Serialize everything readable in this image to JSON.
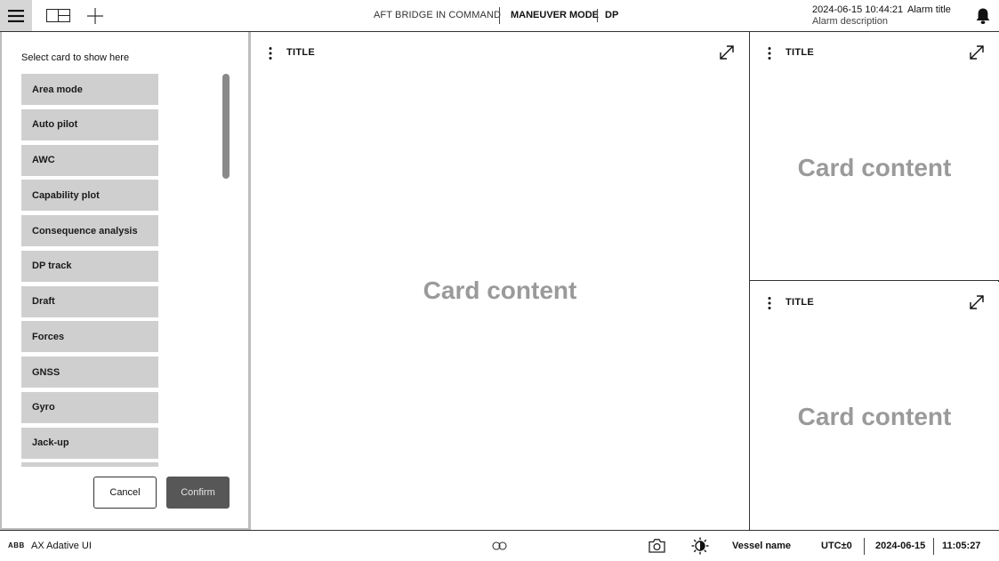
{
  "topbar": {
    "command_status": "AFT BRIDGE IN COMMAND",
    "mode": "MANEUVER MODE",
    "submode": "DP",
    "alarm_time": "2024-06-15 10:44:21",
    "alarm_title": "Alarm title",
    "alarm_description": "Alarm description",
    "icons": {
      "menu": "hamburger-icon",
      "layout": "layout-icon",
      "add": "plus-icon",
      "alarm": "bell-icon"
    }
  },
  "selector": {
    "heading": "Select card to show here",
    "items": [
      "Area mode",
      "Auto pilot",
      "AWC",
      "Capability plot",
      "Consequence analysis",
      "DP track",
      "Draft",
      "Forces",
      "GNSS",
      "Gyro",
      "Jack-up",
      ""
    ],
    "cancel_label": "Cancel",
    "confirm_label": "Confirm"
  },
  "cards": {
    "main": {
      "title": "TITLE",
      "content": "Card content"
    },
    "top_right": {
      "title": "TITLE",
      "content": "Card content"
    },
    "bottom_right": {
      "title": "TITLE",
      "content": "Card content"
    }
  },
  "bottombar": {
    "brand": "ABB",
    "app_name": "AX Adative UI",
    "vessel_name": "Vessel name",
    "utc": "UTC±0",
    "date": "2024-06-15",
    "time": "11:05:27",
    "icons": {
      "link": "link-icon",
      "camera": "camera-icon",
      "brightness": "brightness-icon"
    }
  },
  "colors": {
    "list_item_bg": "#cfcfcf",
    "confirm_bg": "#575757",
    "menu_active_bg": "#d6d6d6",
    "placeholder_text": "#9a9a9a"
  }
}
